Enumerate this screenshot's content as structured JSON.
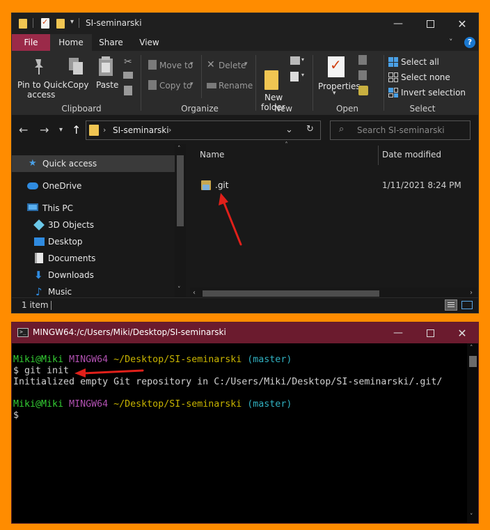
{
  "explorer": {
    "title": "SI-seminarski",
    "tabs": [
      "File",
      "Home",
      "Share",
      "View"
    ],
    "ribbon": {
      "clipboard": {
        "pin_label_1": "Pin to Quick",
        "pin_label_2": "access",
        "copy": "Copy",
        "paste": "Paste",
        "group": "Clipboard"
      },
      "organize": {
        "move_to": "Move to",
        "copy_to": "Copy to",
        "delete": "Delete",
        "rename": "Rename",
        "group": "Organize"
      },
      "new": {
        "folder_1": "New",
        "folder_2": "folder",
        "group": "New"
      },
      "open": {
        "properties": "Properties",
        "group": "Open"
      },
      "select": {
        "select_all": "Select all",
        "select_none": "Select none",
        "invert": "Invert selection",
        "group": "Select"
      }
    },
    "address": {
      "path": "SI-seminarski",
      "search_placeholder": "Search SI-seminarski"
    },
    "nav": {
      "quick_access": "Quick access",
      "onedrive": "OneDrive",
      "this_pc": "This PC",
      "objects3d": "3D Objects",
      "desktop": "Desktop",
      "documents": "Documents",
      "downloads": "Downloads",
      "music": "Music"
    },
    "columns": {
      "name": "Name",
      "date": "Date modified"
    },
    "files": [
      {
        "name": ".git",
        "date": "1/11/2021 8:24 PM"
      }
    ],
    "status": "1 item"
  },
  "terminal": {
    "title": "MINGW64:/c/Users/Miki/Desktop/SI-seminarski",
    "lines": {
      "p1_user": "Miki@Miki",
      "p1_env": "MINGW64",
      "p1_path": "~/Desktop/SI-seminarski",
      "p1_branch": "(master)",
      "cmd": "$ git init",
      "output": "Initialized empty Git repository in C:/Users/Miki/Desktop/SI-seminarski/.git/",
      "p2_user": "Miki@Miki",
      "p2_env": "MINGW64",
      "p2_path": "~/Desktop/SI-seminarski",
      "p2_branch": "(master)",
      "prompt": "$"
    }
  },
  "colors": {
    "file_tab": "#9b2a49",
    "annotation_arrow": "#e0201a",
    "background": "#ff8c00",
    "terminal_title": "#6b1b2e"
  }
}
